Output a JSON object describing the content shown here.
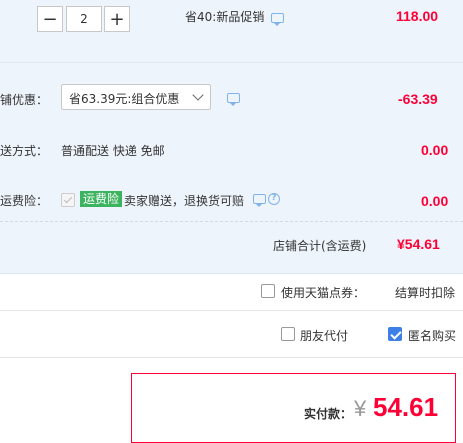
{
  "item": {
    "quantity": "2",
    "minus_glyph": "−",
    "plus_glyph": "+",
    "promo_text": "省40:新品促销",
    "price": "118.00"
  },
  "shop_discount": {
    "label": "铺优惠：",
    "selected_option": "省63.39元:组合优惠",
    "amount": "-63.39"
  },
  "shipping": {
    "label": "送方式：",
    "method": "普通配送 快递 免邮",
    "amount": "0.00"
  },
  "insurance": {
    "label": "运费险：",
    "tag": "运费险",
    "text": "卖家赠送，退换货可赔",
    "amount": "0.00",
    "help_glyph": "?"
  },
  "shop_total": {
    "label": "店铺合计(含运费)",
    "amount": "¥54.61"
  },
  "tmall_points": {
    "label": "使用天猫点券：",
    "note": "结算时扣除"
  },
  "options": {
    "friend_pay_label": "朋友代付",
    "anonymous_label": "匿名购买"
  },
  "payment": {
    "label": "实付款：",
    "currency": "¥",
    "amount": "54.61"
  },
  "colors": {
    "accent_red": "#ff0036",
    "row_blue": "#eef4fb",
    "checkbox_blue": "#3d7fe6",
    "tag_green": "#3cb35f"
  }
}
